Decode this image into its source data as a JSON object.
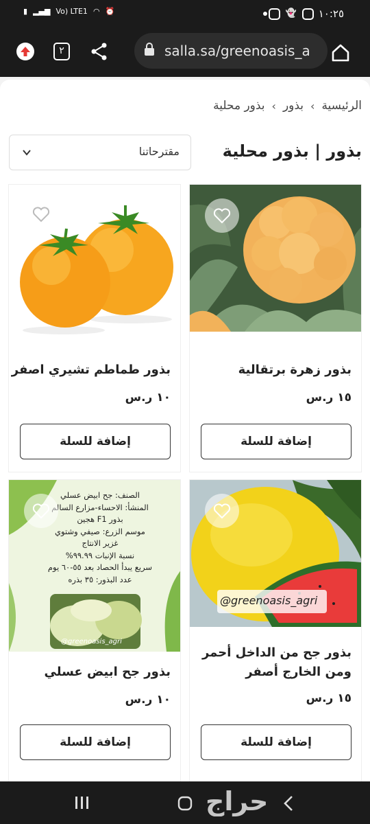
{
  "status_bar": {
    "time": "١٠:٢٥",
    "network": "Vo) LTE1"
  },
  "browser": {
    "url": "salla.sa/greenoasis_a",
    "tab_count": "٢"
  },
  "breadcrumb": {
    "items": [
      "الرئيسية",
      "بذور",
      "بذور محلية"
    ],
    "separator": "›"
  },
  "page_title": "بذور | بذور محلية",
  "sort": {
    "selected": "مقترحاتنا"
  },
  "products": [
    {
      "name": "بذور زهرة برتقالية",
      "price": "١٥ ر.س",
      "button": "إضافة للسلة"
    },
    {
      "name": "بذور طماطم تشيري اصفر",
      "price": "١٠ ر.س",
      "button": "إضافة للسلة"
    },
    {
      "name": "بذور جح من الداخل أحمر ومن الخارج أصفر",
      "price": "١٥ ر.س",
      "button": "إضافة للسلة",
      "watermark": "@greenoasis_agri"
    },
    {
      "name": "بذور جح ابيض عسلي",
      "price": "١٠ ر.س",
      "button": "إضافة للسلة",
      "image_text": [
        "الصنف: جح ابيض عسلي",
        "المنشأ: الاحساء-مزارع السالم",
        "بذور F1 هجين",
        "موسم الزرع: صيفي وشتوي",
        "غزير الانتاج",
        "نسبة الإنبات ٩٩.٩٩%",
        "سريع يبدأ الحصاد بعد ٥٥-٦٠ يوم",
        "عدد البذور: ٣٥ بذره"
      ],
      "image_handle": "@greenoasis_agri"
    }
  ],
  "watermark_logo": "حراج",
  "colors": {
    "system_bar": "#1b1b1b",
    "accent_red": "#e53935"
  }
}
